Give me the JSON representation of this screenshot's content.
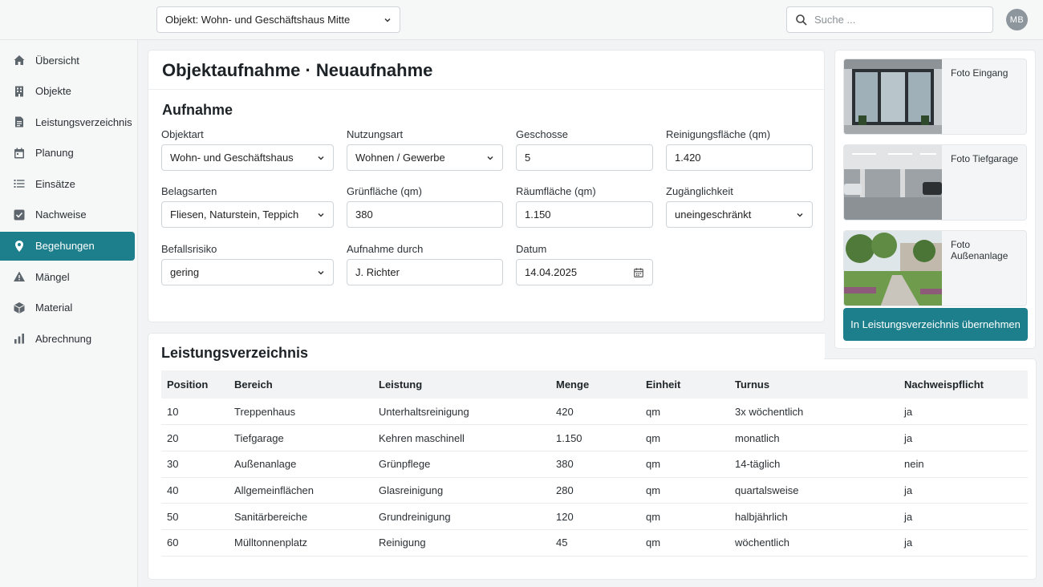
{
  "topbar": {
    "object_select": "Objekt: Wohn- und Geschäftshaus Mitte",
    "search_placeholder": "Suche ...",
    "avatar_initials": "MB"
  },
  "sidebar": {
    "items": [
      {
        "label": "Übersicht",
        "icon": "home-icon"
      },
      {
        "label": "Objekte",
        "icon": "building-icon"
      },
      {
        "label": "Leistungsverzeichnis",
        "icon": "document-icon"
      },
      {
        "label": "Planung",
        "icon": "calendar-icon"
      },
      {
        "label": "Einsätze",
        "icon": "list-icon"
      },
      {
        "label": "Nachweise",
        "icon": "check-square-icon"
      },
      {
        "label": "Begehungen",
        "icon": "map-pin-icon",
        "active": true
      },
      {
        "label": "Mängel",
        "icon": "warning-icon"
      },
      {
        "label": "Material",
        "icon": "box-icon"
      },
      {
        "label": "Abrechnung",
        "icon": "bar-chart-icon"
      }
    ],
    "accent_color": "#1e7f8c"
  },
  "page": {
    "title": "Objektaufnahme · Neuaufnahme"
  },
  "form": {
    "section_title": "Aufnahme",
    "objektart": {
      "label": "Objektart",
      "value": "Wohn- und Geschäftshaus"
    },
    "nutzungsart": {
      "label": "Nutzungsart",
      "value": "Wohnen / Gewerbe"
    },
    "geschosse": {
      "label": "Geschosse",
      "value": "5"
    },
    "reinigungsflaeche": {
      "label": "Reinigungsfläche (qm)",
      "value": "1.420"
    },
    "belagsarten": {
      "label": "Belagsarten",
      "value": "Fliesen, Naturstein, Teppich"
    },
    "gruenflaeche": {
      "label": "Grünfläche (qm)",
      "value": "380"
    },
    "raeumflaeche": {
      "label": "Räumfläche (qm)",
      "value": "1.150"
    },
    "zugaenglichkeit": {
      "label": "Zugänglichkeit",
      "value": "uneingeschränkt"
    },
    "befallsrisiko": {
      "label": "Befallsrisiko",
      "value": "gering"
    },
    "aufnahme_durch": {
      "label": "Aufnahme durch",
      "value": "J. Richter"
    },
    "datum": {
      "label": "Datum",
      "value": "14.04.2025"
    }
  },
  "photos": {
    "items": [
      {
        "caption": "Foto Eingang"
      },
      {
        "caption": "Foto Tiefgarage"
      },
      {
        "caption": "Foto Außenanlage"
      }
    ],
    "apply_button": "In Leistungsverzeichnis übernehmen"
  },
  "leistungsverzeichnis": {
    "title": "Leistungsverzeichnis",
    "columns": [
      "Position",
      "Bereich",
      "Leistung",
      "Menge",
      "Einheit",
      "Turnus",
      "Nachweispflicht"
    ],
    "rows": [
      [
        "10",
        "Treppenhaus",
        "Unterhaltsreinigung",
        "420",
        "qm",
        "3x wöchentlich",
        "ja"
      ],
      [
        "20",
        "Tiefgarage",
        "Kehren maschinell",
        "1.150",
        "qm",
        "monatlich",
        "ja"
      ],
      [
        "30",
        "Außenanlage",
        "Grünpflege",
        "380",
        "qm",
        "14-täglich",
        "nein"
      ],
      [
        "40",
        "Allgemeinflächen",
        "Glasreinigung",
        "280",
        "qm",
        "quartalsweise",
        "ja"
      ],
      [
        "50",
        "Sanitärbereiche",
        "Grundreinigung",
        "120",
        "qm",
        "halbjährlich",
        "ja"
      ],
      [
        "60",
        "Mülltonnenplatz",
        "Reinigung",
        "45",
        "qm",
        "wöchentlich",
        "ja"
      ]
    ]
  }
}
